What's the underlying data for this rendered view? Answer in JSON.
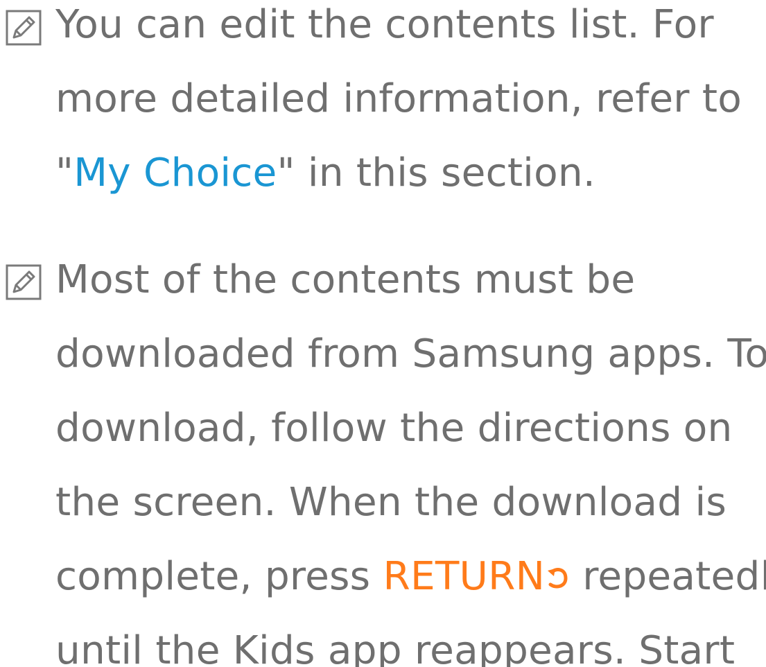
{
  "notes": [
    {
      "icon": "note-pencil-icon",
      "line1": "You can edit the contents list. For",
      "line2": "more detailed information, refer to",
      "line3_open_quote": "\"",
      "line3_link": "My Choice",
      "line3_rest": "\" in this section."
    },
    {
      "icon": "note-pencil-icon",
      "line1": "Most of the contents must be",
      "line2": "downloaded from Samsung apps. To",
      "line3": "download, follow the directions on",
      "line4": "the screen. When the download is",
      "line5_before": "complete, press ",
      "line5_key": "RETURN",
      "line5_key_icon": "return-arrow-icon",
      "line5_after": " repeatedly",
      "line6": "until the Kids app reappears. Start"
    }
  ],
  "colors": {
    "text": "#6f6f6f",
    "link": "#1a96d3",
    "key": "#ff7b1a"
  }
}
